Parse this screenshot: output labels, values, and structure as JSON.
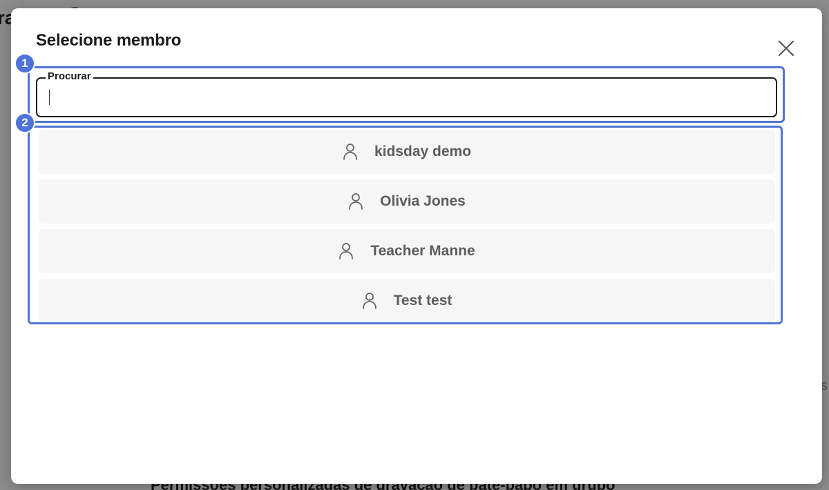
{
  "background": {
    "title_fragment": "rações  ⓘ",
    "bottom_text": "Permissões personalizadas de gravação de bate-papo em grupo",
    "right_fragment": "s"
  },
  "modal": {
    "title": "Selecione membro",
    "close_icon": "close-icon"
  },
  "search": {
    "label": "Procurar",
    "value": "",
    "placeholder": ""
  },
  "members": [
    {
      "name": "kidsday demo",
      "icon": "user-icon"
    },
    {
      "name": "Olivia Jones",
      "icon": "user-icon"
    },
    {
      "name": "Teacher Manne",
      "icon": "user-icon"
    },
    {
      "name": "Test test",
      "icon": "user-icon"
    }
  ],
  "annotations": [
    {
      "label": "1"
    },
    {
      "label": "2"
    }
  ],
  "colors": {
    "highlight": "#4e73d9",
    "item_bg": "#f6f6f6",
    "item_text": "#5c5c5c"
  }
}
